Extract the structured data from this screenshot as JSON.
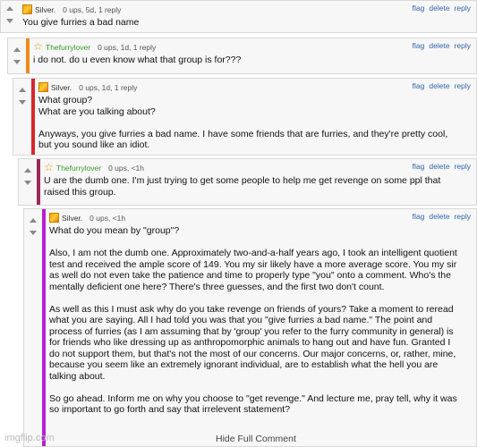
{
  "colors": {
    "level1": "#ffffff",
    "level2": "#f08a1c",
    "level3": "#d8262d",
    "level4": "#9b2a57",
    "level5": "#b71fd1"
  },
  "actions": {
    "flag": "flag",
    "delete": "delete",
    "reply": "reply"
  },
  "comments": [
    {
      "user": "Silver.",
      "meta": "0 ups, 5d, 1 reply",
      "text": "You give furries a bad name"
    },
    {
      "user": "Thefurrylover",
      "meta": "0 ups, 1d, 1 reply",
      "text": "i do not. do u even know what that group is for???"
    },
    {
      "user": "Silver.",
      "meta": "0 ups, 1d, 1 reply",
      "text": "What group?\nWhat are you talking about?\n\nAnyways, you give furries a bad name. I have some friends that are furries, and they're pretty cool,\nbut you sound like an idiot."
    },
    {
      "user": "Thefurrylover",
      "meta": "0 ups, <1h",
      "text": "U are the dumb one. I'm just trying to get some people to help me get revenge on some ppl that\nraised this group."
    },
    {
      "user": "Silver.",
      "meta": "0 ups, <1h",
      "text": "What do you mean by \"group\"?\n\nAlso, I am not the dumb one. Approximately two-and-a-half years ago, I took an intelligent quotient\ntest and received the ample score of 149. You my sir likely have a more average score. You my sir\nas well do not even take the patience and time to properly type \"you\" onto a comment. Who's the\nmentally deficient one here? There's three guesses, and the first two don't count.\n\nAs well as this I must ask why do you take revenge on friends of yours? Take a moment to reread\nwhat you are saying. All I had told you was that you \"give furries a bad name.\" The point and\nprocess of furries (as I am assuming that by 'group' you refer to the furry community in general) is\nfor friends who like dressing up as anthropomorphic animals to hang out and have fun. Granted I\ndo not support them, but that's not the most of our concerns. Our major concerns, or, rather, mine,\nbecause you seem like an extremely ignorant individual, are to establish what the hell you are\ntalking about.\n\nSo go ahead. Inform me on why you choose to \"get revenge.\" And lecture me, pray tell, why it was\nso important to go forth and say that irrelevent statement?"
    }
  ],
  "footer": {
    "hide_label": "Hide Full Comment",
    "watermark": "imgflip.com"
  }
}
